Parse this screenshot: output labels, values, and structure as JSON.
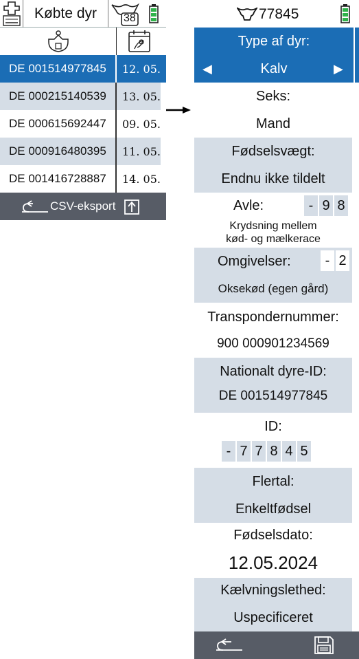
{
  "left": {
    "title": "Købte dyr",
    "count_badge": "38",
    "icons": {
      "tag": "ear-tag-icon",
      "calendar": "calendar-icon",
      "cow": "cow-head-icon",
      "battery": "battery-icon"
    },
    "rows": [
      {
        "id": "DE 001514977845",
        "date": "12. 05.",
        "selected": true
      },
      {
        "id": "DE 000215140539",
        "date": "13. 05.",
        "selected": false
      },
      {
        "id": "DE 000615692447",
        "date": "09. 05.",
        "selected": false
      },
      {
        "id": "DE 000916480395",
        "date": "11. 05.",
        "selected": false
      },
      {
        "id": "DE 001416728887",
        "date": "14. 05.",
        "selected": false
      }
    ],
    "footer": {
      "export_label": "CSV-eksport"
    }
  },
  "right": {
    "header": {
      "animal_number": "77845"
    },
    "type": {
      "label": "Type af dyr:",
      "value": "Kalv"
    },
    "sex": {
      "label": "Seks:",
      "value": "Mand"
    },
    "birth_weight": {
      "label": "Fødselsvægt:",
      "value": "Endnu ikke tildelt"
    },
    "breed": {
      "label": "Avle:",
      "digits": [
        "-",
        "9",
        "8"
      ],
      "description_line1": "Krydsning mellem",
      "description_line2": "kød- og mælkerace"
    },
    "environment": {
      "label": "Omgivelser:",
      "digits": [
        "-",
        "2"
      ],
      "value": "Oksekød (egen gård)"
    },
    "transponder": {
      "label": "Transpondernummer:",
      "value": "900 000901234569"
    },
    "national_id": {
      "label": "Nationalt dyre-ID:",
      "value": "DE 001514977845"
    },
    "id": {
      "label": "ID:",
      "digits": [
        "-",
        "7",
        "7",
        "8",
        "4",
        "5"
      ]
    },
    "plural": {
      "label": "Flertal:",
      "value": "Enkeltfødsel"
    },
    "birth_date": {
      "label": "Fødselsdato:",
      "value": "12.05.2024"
    },
    "calving_ease": {
      "label": "Kælvningslethed:",
      "value": "Uspecificeret"
    }
  },
  "colors": {
    "selected_blue": "#1b6db5",
    "row_alt": "#d5dde6",
    "footer_gray": "#575c66",
    "battery_green": "#2fb34a"
  }
}
